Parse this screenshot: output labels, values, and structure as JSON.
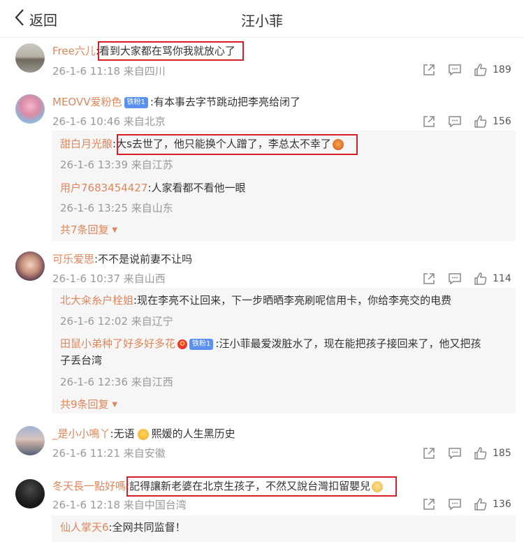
{
  "header": {
    "back_label": "返回",
    "title": "汪小菲"
  },
  "icons": {
    "back": "chevron-left-icon",
    "share": "share-icon",
    "reply": "comment-icon",
    "like": "thumbs-up-icon"
  },
  "colors": {
    "username": "#e0865a",
    "highlight": "#d61f26",
    "meta": "#999999",
    "reply_bg": "#f6f6f6",
    "badge": "#5b8ff0"
  },
  "comments": [
    {
      "user": "Free六儿",
      "sep": ":",
      "text": "看到大家都在骂你我就放心了",
      "time": "26-1-6 11:18",
      "location": "来自四川",
      "likes": "189"
    },
    {
      "user": "MEOVV爱粉色",
      "badge": "铁粉1",
      "sep": ":",
      "text": "有本事去字节跳动把李亮给闭了",
      "time": "26-1-6 10:46",
      "location": "来自北京",
      "likes": "156",
      "replies": [
        {
          "user": "甜白月光酿",
          "sep": ":",
          "text": "大s去世了，他只能换个人蹭了，李总太不幸了",
          "time": "26-1-6 13:39",
          "location": "来自江苏"
        },
        {
          "user": "用户7683454427",
          "sep": ":",
          "text": "人家看都不看他一眼",
          "time": "26-1-6 13:25",
          "location": "来自山东"
        }
      ],
      "more": "共7条回复"
    },
    {
      "user": "可乐爱思",
      "sep": ":",
      "text": "不不是说前妻不让吗",
      "time": "26-1-6 10:37",
      "location": "来自山西",
      "likes": "114",
      "replies": [
        {
          "user": "北大籴糸户栓姐",
          "sep": ":",
          "text": "现在李亮不让回来，下一步晒晒李亮刷呢信用卡，你给李亮交的电费",
          "time": "26-1-6 12:02",
          "location": "来自辽宁"
        },
        {
          "user": "田鼠小弟种了好多好多花",
          "badge": "铁粉1",
          "sep": ":",
          "text": "汪小菲最爱泼脏水了，现在能把孩子接回来了，他又把孩",
          "text2": "子丢台湾",
          "time": "26-1-6 12:36",
          "location": "来自江西"
        }
      ],
      "more": "共9条回复"
    },
    {
      "user": "_是小小鳴丫",
      "sep": ":",
      "text": "无语",
      "text_after": "熙媛的人生黑历史",
      "time": "26-1-6 11:21",
      "location": "来自安徽",
      "likes": "185"
    },
    {
      "user": "冬天長一點好嗎",
      "sep": ":",
      "text": "記得讓新老婆在北京生孩子，不然又說台灣扣留嬰兒",
      "time": "26-1-6 12:18",
      "location": "来自中国台湾",
      "likes": "136",
      "replies": [
        {
          "user": "仙人掌天6",
          "sep": ":",
          "text": "全网共同监督！"
        }
      ]
    }
  ]
}
